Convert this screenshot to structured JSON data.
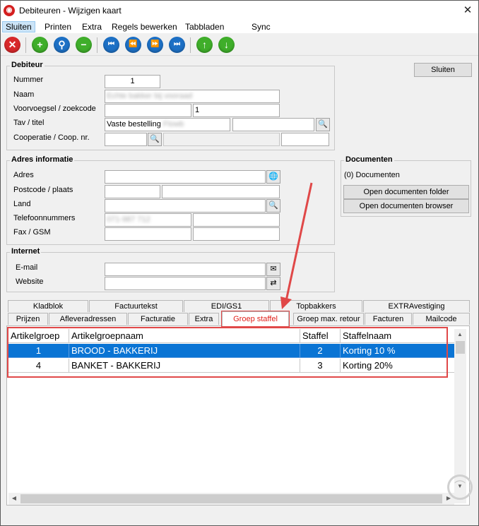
{
  "window": {
    "title": "Debiteuren - Wijzigen kaart",
    "close_glyph": "✕"
  },
  "menu": {
    "items": [
      "Sluiten",
      "Printen",
      "Extra",
      "Regels bewerken",
      "Tabbladen",
      "Sync"
    ]
  },
  "toolbar": {
    "buttons": [
      {
        "name": "close-record-button",
        "icon": "close-icon",
        "glyph": "✕",
        "color": "#d8282a"
      },
      {
        "name": "add-button",
        "icon": "plus-icon",
        "glyph": "+",
        "color": "#3fae2a"
      },
      {
        "name": "search-button",
        "icon": "search-icon",
        "glyph": "⚲",
        "color": "#1d70c5"
      },
      {
        "name": "delete-button",
        "icon": "minus-icon",
        "glyph": "−",
        "color": "#3fae2a"
      },
      {
        "name": "first-record-button",
        "icon": "first-icon",
        "glyph": "⏮",
        "color": "#1d70c5"
      },
      {
        "name": "previous-record-button",
        "icon": "rewind-icon",
        "glyph": "⏪",
        "color": "#1d70c5"
      },
      {
        "name": "next-record-button",
        "icon": "forward-icon",
        "glyph": "⏩",
        "color": "#1d70c5"
      },
      {
        "name": "last-record-button",
        "icon": "last-icon",
        "glyph": "⏭",
        "color": "#1d70c5"
      },
      {
        "name": "move-up-button",
        "icon": "arrow-up-icon",
        "glyph": "↑",
        "color": "#3fae2a"
      },
      {
        "name": "move-down-button",
        "icon": "arrow-down-icon",
        "glyph": "↓",
        "color": "#3fae2a"
      }
    ]
  },
  "debiteur": {
    "title": "Debiteur",
    "close_button": "Sluiten",
    "labels": {
      "nummer": "Nummer",
      "naam": "Naam",
      "voorvoegsel": "Voorvoegsel / zoekcode",
      "tav": "Tav / titel",
      "cooperatie": "Cooperatie / Coop. nr."
    },
    "values": {
      "nummer": "1",
      "naam": "Echte bakker bij vooraad",
      "voorvoegsel": "",
      "zoekcode": "1",
      "tav": "Vaste bestelling",
      "tav_extra": "Flowb",
      "titel": "",
      "cooperatie": "",
      "coop_nr": ""
    }
  },
  "adres": {
    "title": "Adres informatie",
    "labels": {
      "adres": "Adres",
      "postcode": "Postcode / plaats",
      "land": "Land",
      "telefoon": "Telefoonnummers",
      "fax": "Fax / GSM"
    },
    "values": {
      "adres": "",
      "postcode": "",
      "plaats": "",
      "land": "",
      "telefoon1": "071-987 712",
      "telefoon2": "",
      "fax": "",
      "gsm": ""
    }
  },
  "documenten": {
    "title": "Documenten",
    "count_text": "(0) Documenten",
    "open_folder": "Open documenten folder",
    "open_browser": "Open documenten browser"
  },
  "internet": {
    "title": "Internet",
    "labels": {
      "email": "E-mail",
      "website": "Website"
    },
    "values": {
      "email": "",
      "website": ""
    }
  },
  "tabs": {
    "row1": [
      "Kladblok",
      "Factuurtekst",
      "EDI/GS1",
      "Topbakkers",
      "EXTRAvestiging"
    ],
    "row2": [
      "Prijzen",
      "Afleveradressen",
      "Facturatie",
      "Extra",
      "Groep staffel",
      "Groep max. retour",
      "Facturen",
      "Mailcode"
    ],
    "selected": "Groep staffel"
  },
  "grid": {
    "columns": [
      "Artikelgroep",
      "Artikelgroepnaam",
      "Staffel",
      "Staffelnaam"
    ],
    "rows": [
      {
        "artikelgroep": "1",
        "naam": "BROOD - BAKKERIJ",
        "staffel": "2",
        "staffelnaam": "Korting 10 %"
      },
      {
        "artikelgroep": "4",
        "naam": "BANKET - BAKKERIJ",
        "staffel": "3",
        "staffelnaam": "Korting 20%"
      }
    ]
  },
  "colors": {
    "highlight": "#e04848",
    "selection": "#0a74d4",
    "selected_tab_text": "#e0201a"
  }
}
